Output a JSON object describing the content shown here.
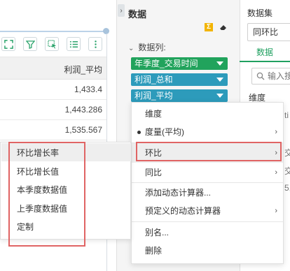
{
  "table": {
    "header": "利润_平均",
    "rows": [
      "1,433.4",
      "1,443.286",
      "1,535.567"
    ]
  },
  "toolbar": {
    "icons": [
      "expand-icon",
      "filter-icon",
      "select-icon",
      "list-icon",
      "more-icon"
    ]
  },
  "data_panel": {
    "title": "数据",
    "columns_label": "数据列:",
    "fields": [
      {
        "label": "年季度_交易时间",
        "color": "#21a35c"
      },
      {
        "label": "利润_总和",
        "color": "#2d9bbb"
      },
      {
        "label": "利润_平均",
        "color": "#2d9bbb"
      }
    ],
    "sigma": "Σ"
  },
  "dataset_panel": {
    "title": "数据集",
    "selected": "同环比",
    "tab": "数据",
    "search_placeholder": "输入搜",
    "dimension_label": "维度",
    "ghost": [
      "ti",
      "交",
      "交",
      "5,"
    ]
  },
  "context_menu": {
    "items": [
      {
        "label": "维度",
        "has_submenu": false,
        "checked": false
      },
      {
        "label": "度量(平均)",
        "has_submenu": true,
        "checked": true
      },
      {
        "label": "环比",
        "has_submenu": true,
        "checked": false,
        "highlighted": true
      },
      {
        "label": "同比",
        "has_submenu": true,
        "checked": false
      },
      {
        "label": "添加动态计算器...",
        "has_submenu": false,
        "checked": false
      },
      {
        "label": "预定义的动态计算器",
        "has_submenu": true,
        "checked": false
      },
      {
        "label": "别名...",
        "has_submenu": false,
        "checked": false
      },
      {
        "label": "删除",
        "has_submenu": false,
        "checked": false
      }
    ]
  },
  "submenu": {
    "items": [
      "环比增长率",
      "环比增长值",
      "本季度数据值",
      "上季度数据值",
      "定制"
    ]
  },
  "colors": {
    "highlight_border": "#e06464",
    "accent_green": "#20a060"
  }
}
